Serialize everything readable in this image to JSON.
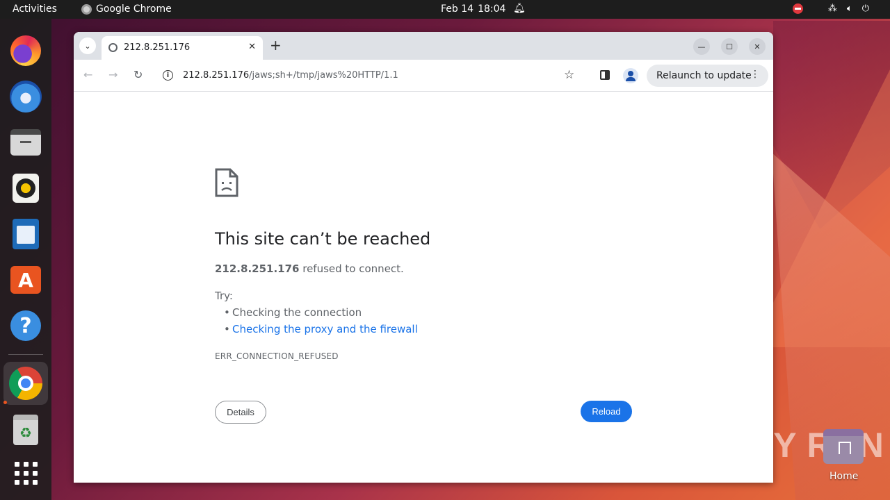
{
  "topbar": {
    "activities": "Activities",
    "app_name": "Google Chrome",
    "date": "Feb 14",
    "time": "18:04"
  },
  "dock": {
    "items": [
      "firefox",
      "thunderbird",
      "files",
      "rhythmbox",
      "libreoffice-writer",
      "app-center",
      "help",
      "google-chrome",
      "trash",
      "show-apps"
    ]
  },
  "browser": {
    "tab": {
      "title": "212.8.251.176"
    },
    "url": {
      "host": "212.8.251.176",
      "path": "/jaws;sh+/tmp/jaws%20HTTP/1.1"
    },
    "relaunch_label": "Relaunch to update"
  },
  "page": {
    "headline": "This site can’t be reached",
    "summary_host": "212.8.251.176",
    "summary_rest": " refused to connect.",
    "try_label": "Try:",
    "suggestions": [
      "Checking the connection",
      "Checking the proxy and the firewall"
    ],
    "error_code": "ERR_CONNECTION_REFUSED",
    "details_button": "Details",
    "reload_button": "Reload"
  },
  "desktop": {
    "home_label": "Home",
    "watermark": "ANY RUN"
  },
  "colors": {
    "link": "#1a73e8",
    "reload_button": "#1a73e8",
    "topbar": "#1d1d1d"
  }
}
